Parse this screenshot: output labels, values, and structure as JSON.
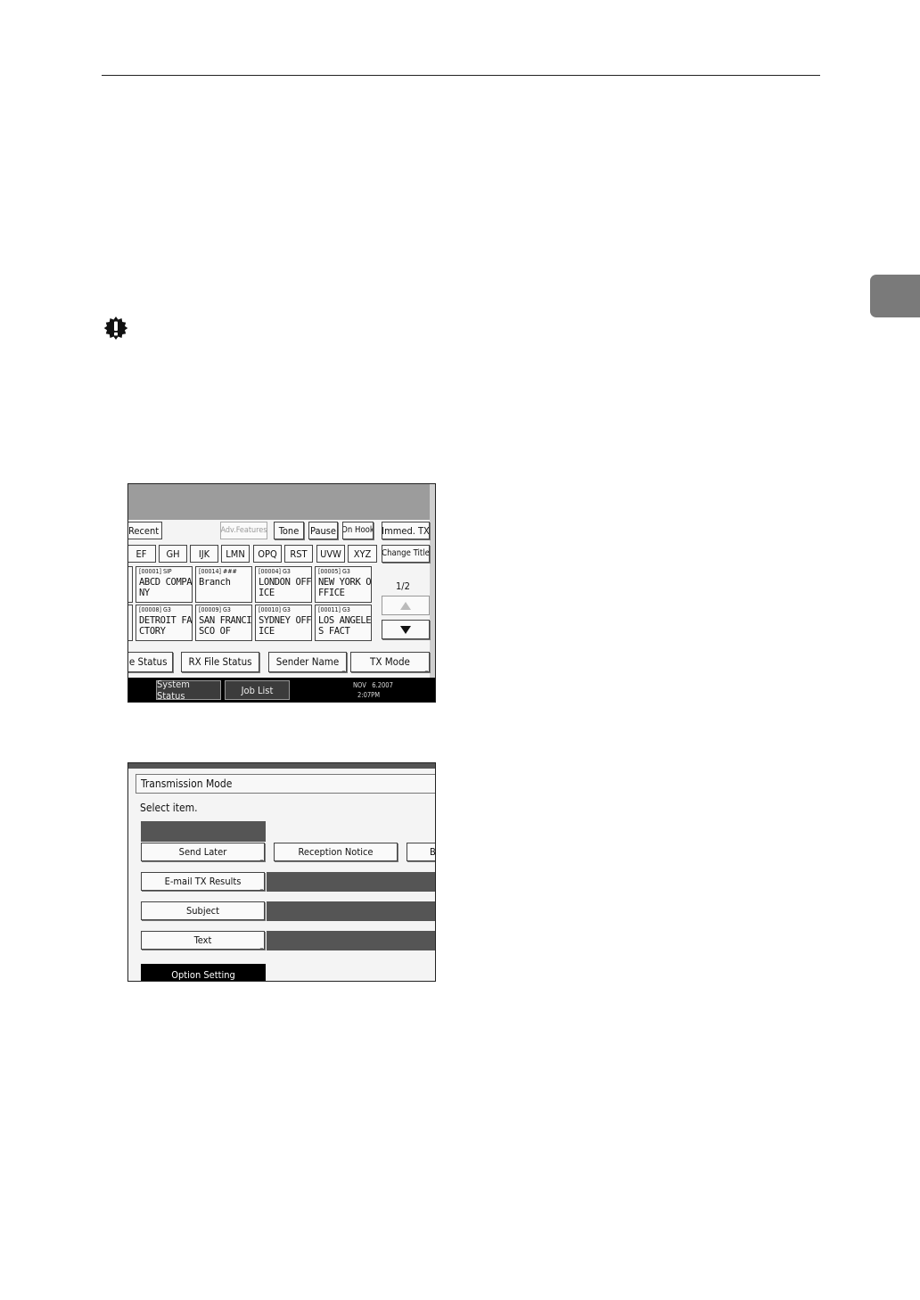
{
  "side_tab_color": "#7a7a7a",
  "icons": {
    "important": "important-exclamation-icon"
  },
  "screen1": {
    "top_row": [
      "Recent",
      "Adv.Features",
      "Tone",
      "Pause",
      "On Hook",
      "Immed. TX"
    ],
    "index_tabs": [
      "EF",
      "GH",
      "IJK",
      "LMN",
      "OPQ",
      "RST",
      "UVW",
      "XYZ"
    ],
    "change_title": "Change Title",
    "destinations": [
      {
        "code": "[00001] SIP",
        "name": "ABCD COMPA\nNY"
      },
      {
        "code": "[00014] ###",
        "name": "Branch"
      },
      {
        "code": "[00004] G3",
        "name": "LONDON OFF\nICE"
      },
      {
        "code": "[00005] G3",
        "name": "NEW YORK O\nFFICE"
      },
      {
        "code": "[00008] G3",
        "name": "DETROIT FA\nCTORY"
      },
      {
        "code": "[00009] G3",
        "name": "SAN FRANCI\nSCO OF"
      },
      {
        "code": "[00010] G3",
        "name": "SYDNEY OFF\nICE"
      },
      {
        "code": "[00011] G3",
        "name": "LOS ANGELE\nS FACT"
      }
    ],
    "page_indicator": "1/2",
    "bottom_row": [
      "le Status",
      "RX File Status",
      "Sender Name",
      "TX Mode"
    ],
    "status_bar": {
      "system_status": "System Status",
      "job_list": "Job List",
      "date": "NOV   6.2007",
      "time": "2:07PM"
    }
  },
  "screen2": {
    "title": "Transmission Mode",
    "prompt": "Select item.",
    "buttons": {
      "send_later": "Send Later",
      "reception_notice": "Reception Notice",
      "cut_off": "B",
      "email_tx_results": "E-mail TX Results",
      "subject": "Subject",
      "text": "Text",
      "option_setting": "Option Setting"
    }
  }
}
